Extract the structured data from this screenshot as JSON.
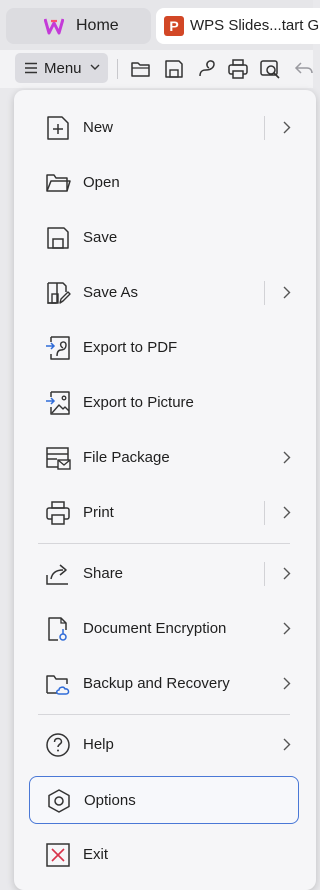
{
  "tabs": [
    {
      "label": "Home",
      "icon": "wps-logo-icon"
    },
    {
      "label": "WPS Slides...tart G",
      "icon": "ppt-icon",
      "badge": "P"
    }
  ],
  "toolbar": {
    "menu_label": "Menu",
    "icons": [
      "open-folder-icon",
      "save-icon",
      "export-pdf-icon",
      "print-icon",
      "print-preview-icon",
      "undo-icon"
    ]
  },
  "menu": {
    "items": [
      {
        "label": "New",
        "icon": "new-icon",
        "submenu": true,
        "split": true
      },
      {
        "label": "Open",
        "icon": "open-icon",
        "submenu": false,
        "split": false
      },
      {
        "label": "Save",
        "icon": "save-icon",
        "submenu": false,
        "split": false
      },
      {
        "label": "Save As",
        "icon": "save-as-icon",
        "submenu": true,
        "split": true
      },
      {
        "label": "Export to PDF",
        "icon": "export-pdf-icon",
        "submenu": false,
        "split": false
      },
      {
        "label": "Export to Picture",
        "icon": "export-picture-icon",
        "submenu": false,
        "split": false
      },
      {
        "label": "File Package",
        "icon": "file-package-icon",
        "submenu": true,
        "split": false
      },
      {
        "label": "Print",
        "icon": "print-icon",
        "submenu": true,
        "split": true
      },
      {
        "label": "Share",
        "icon": "share-icon",
        "submenu": true,
        "split": true
      },
      {
        "label": "Document Encryption",
        "icon": "document-encryption-icon",
        "submenu": true,
        "split": false
      },
      {
        "label": "Backup and Recovery",
        "icon": "backup-recovery-icon",
        "submenu": true,
        "split": false
      },
      {
        "label": "Help",
        "icon": "help-icon",
        "submenu": true,
        "split": false
      },
      {
        "label": "Options",
        "icon": "options-icon",
        "submenu": false,
        "split": false,
        "selected": true
      },
      {
        "label": "Exit",
        "icon": "exit-icon",
        "submenu": false,
        "split": false
      }
    ]
  },
  "colors": {
    "accent": "#4a78d6",
    "exit": "#d8324a",
    "ppt": "#d24726",
    "wps_logo": "#c43bd8"
  }
}
